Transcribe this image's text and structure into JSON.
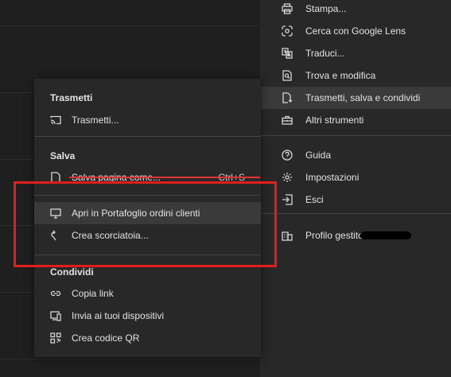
{
  "main_menu": {
    "items": [
      {
        "label": "Stampa...",
        "icon": "printer-icon"
      },
      {
        "label": "Cerca con Google Lens",
        "icon": "lens-icon"
      },
      {
        "label": "Traduci...",
        "icon": "translate-icon"
      },
      {
        "label": "Trova e modifica",
        "icon": "find-icon"
      },
      {
        "label": "Trasmetti, salva e condividi",
        "icon": "cast-save-share-icon"
      },
      {
        "label": "Altri strumenti",
        "icon": "toolbox-icon"
      },
      {
        "label": "Guida",
        "icon": "help-icon"
      },
      {
        "label": "Impostazioni",
        "icon": "gear-icon"
      },
      {
        "label": "Esci",
        "icon": "exit-icon"
      },
      {
        "label": "Profilo gestito",
        "icon": "building-icon"
      }
    ]
  },
  "sub_menu": {
    "section_cast": "Trasmetti",
    "cast_item": "Trasmetti...",
    "section_save": "Salva",
    "save_page": "Salva pagina come...",
    "save_shortcut": "Ctrl+S",
    "open_in": "Apri in Portafoglio ordini clienti",
    "shortcut": "Crea scorciatoia...",
    "section_share": "Condividi",
    "copy_link": "Copia link",
    "send_devices": "Invia ai tuoi dispositivi",
    "qr_code": "Crea codice QR"
  },
  "colors": {
    "highlight_box": "#e01e1e",
    "menu_bg": "#282828",
    "hover_bg": "#3a3a3a"
  }
}
